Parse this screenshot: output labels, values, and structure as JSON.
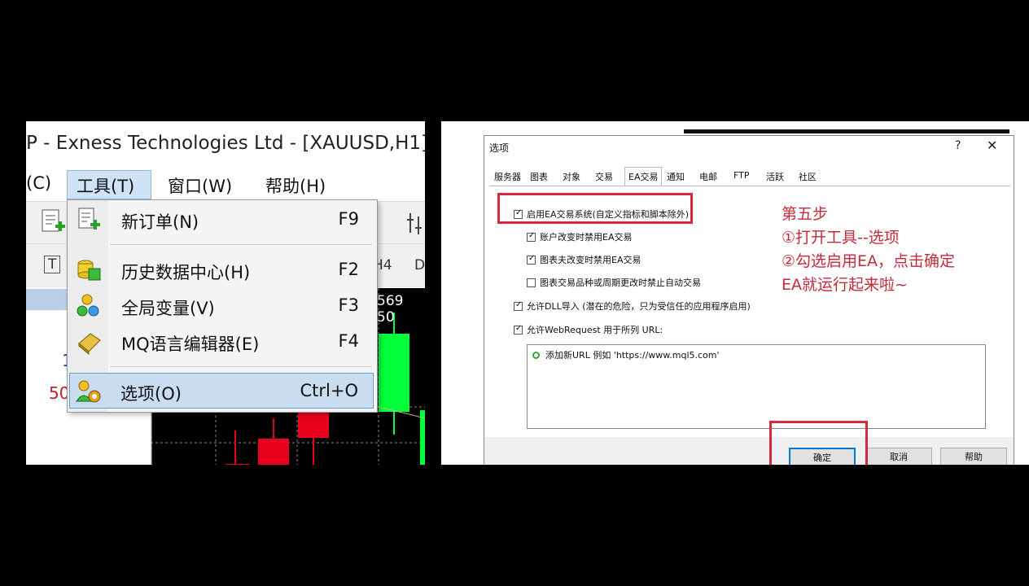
{
  "left": {
    "window_title": "P - Exness Technologies Ltd - [XAUUSD,H1]",
    "menubar": {
      "item_c": "(C)",
      "tools": "工具(T)",
      "window": "窗口(W)",
      "help": "帮助(H)"
    },
    "toolbar2": {
      "label_t": "T",
      "label_h4": "H4",
      "label_d": "D"
    },
    "side_numbers": [
      "1",
      "50"
    ],
    "chart_price": "569 50",
    "dropdown": {
      "items": [
        {
          "label": "新订单(N)",
          "shortcut": "F9",
          "icon": "new-order-icon"
        },
        {
          "label": "历史数据中心(H)",
          "shortcut": "F2",
          "icon": "history-center-icon"
        },
        {
          "label": "全局变量(V)",
          "shortcut": "F3",
          "icon": "global-variables-icon"
        },
        {
          "label": "MQ语言编辑器(E)",
          "shortcut": "F4",
          "icon": "editor-icon"
        },
        {
          "label": "选项(O)",
          "shortcut": "Ctrl+O",
          "icon": "options-icon"
        }
      ],
      "selected_index": 4
    }
  },
  "dialog": {
    "title": "选项",
    "help_glyph": "?",
    "close_glyph": "✕",
    "tabs": [
      "服务器",
      "图表",
      "对象",
      "交易",
      "EA交易",
      "通知",
      "电邮",
      "FTP",
      "活跃",
      "社区"
    ],
    "active_tab": "EA交易",
    "options": [
      {
        "label": "启用EA交易系统(自定义指标和脚本除外)",
        "checked": true
      },
      {
        "label": "账户改变时禁用EA交易",
        "checked": true
      },
      {
        "label": "图表夫改变时禁用EA交易",
        "checked": true
      },
      {
        "label": "图表交易品种或周期更改时禁止自动交易",
        "checked": false
      },
      {
        "label": "允许DLL导入 (潜在的危险，只为受信任的应用程序启用)",
        "checked": true
      },
      {
        "label": "允许WebRequest 用于所列 URL:",
        "checked": true
      }
    ],
    "url_placeholder": "添加新URL 例如 'https://www.mql5.com'",
    "buttons": {
      "ok": "确定",
      "cancel": "取消",
      "help": "帮助"
    }
  },
  "annotation": {
    "lines": [
      "第五步",
      "①打开工具--选项",
      "②勾选启用EA，点击确定",
      "EA就运行起来啦~"
    ],
    "color": "#c42a3a"
  },
  "colors": {
    "menu_highlight": "#c9dcf0",
    "bull_candle": "#00ff3a",
    "bear_candle": "#e8001c",
    "annotation_red": "#d62a3c"
  }
}
